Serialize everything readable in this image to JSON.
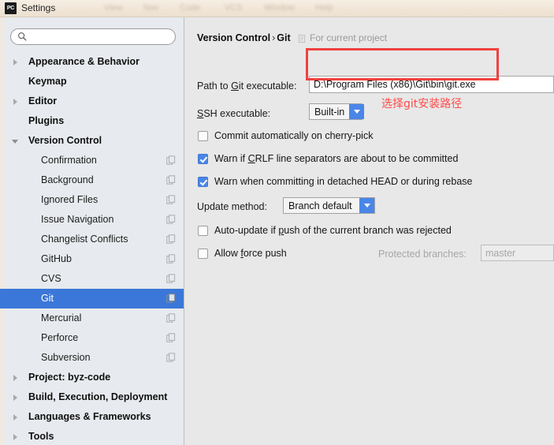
{
  "window": {
    "title": "Settings",
    "app_icon": "PC",
    "blurred_menu_items": [
      "View",
      "Nav",
      "Code",
      "VCS",
      "Window",
      "Help"
    ]
  },
  "sidebar": {
    "search": {
      "value": "",
      "placeholder": "",
      "icon": "search-icon"
    },
    "items": [
      {
        "label": "Appearance & Behavior",
        "level": "top",
        "arrow": "collapsed",
        "selected": false,
        "copy_icon": false
      },
      {
        "label": "Keymap",
        "level": "top",
        "arrow": "none",
        "selected": false,
        "copy_icon": false
      },
      {
        "label": "Editor",
        "level": "top",
        "arrow": "collapsed",
        "selected": false,
        "copy_icon": false
      },
      {
        "label": "Plugins",
        "level": "top",
        "arrow": "none",
        "selected": false,
        "copy_icon": false
      },
      {
        "label": "Version Control",
        "level": "top",
        "arrow": "expanded",
        "selected": false,
        "copy_icon": false
      },
      {
        "label": "Confirmation",
        "level": "child",
        "arrow": "none",
        "selected": false,
        "copy_icon": true
      },
      {
        "label": "Background",
        "level": "child",
        "arrow": "none",
        "selected": false,
        "copy_icon": true
      },
      {
        "label": "Ignored Files",
        "level": "child",
        "arrow": "none",
        "selected": false,
        "copy_icon": true
      },
      {
        "label": "Issue Navigation",
        "level": "child",
        "arrow": "none",
        "selected": false,
        "copy_icon": true
      },
      {
        "label": "Changelist Conflicts",
        "level": "child",
        "arrow": "none",
        "selected": false,
        "copy_icon": true
      },
      {
        "label": "GitHub",
        "level": "child",
        "arrow": "none",
        "selected": false,
        "copy_icon": true
      },
      {
        "label": "CVS",
        "level": "child",
        "arrow": "none",
        "selected": false,
        "copy_icon": true
      },
      {
        "label": "Git",
        "level": "child",
        "arrow": "none",
        "selected": true,
        "copy_icon": true
      },
      {
        "label": "Mercurial",
        "level": "child",
        "arrow": "none",
        "selected": false,
        "copy_icon": true
      },
      {
        "label": "Perforce",
        "level": "child",
        "arrow": "none",
        "selected": false,
        "copy_icon": true
      },
      {
        "label": "Subversion",
        "level": "child",
        "arrow": "none",
        "selected": false,
        "copy_icon": true
      },
      {
        "label": "Project: byz-code",
        "level": "top",
        "arrow": "collapsed",
        "selected": false,
        "copy_icon": false
      },
      {
        "label": "Build, Execution, Deployment",
        "level": "top",
        "arrow": "collapsed",
        "selected": false,
        "copy_icon": false
      },
      {
        "label": "Languages & Frameworks",
        "level": "top",
        "arrow": "collapsed",
        "selected": false,
        "copy_icon": false
      },
      {
        "label": "Tools",
        "level": "top",
        "arrow": "collapsed",
        "selected": false,
        "copy_icon": false
      }
    ]
  },
  "panel": {
    "breadcrumb_parent": "Version Control",
    "breadcrumb_sep": "›",
    "breadcrumb_current": "Git",
    "scope_text": "For current project",
    "scope_icon": "project-scope-icon",
    "git_path": {
      "label_pre": "Path to ",
      "label_accel": "G",
      "label_post": "it executable:",
      "value": "D:\\Program Files (x86)\\Git\\bin\\git.exe"
    },
    "ssh": {
      "label": "SSH executable:",
      "label_accel": "S",
      "value": "Built-in"
    },
    "checkboxes": [
      {
        "label_pre": "Commit automatically on cherry-pick",
        "accel": "",
        "label_post": "",
        "checked": false,
        "disabled": false
      },
      {
        "label_pre": "Warn if ",
        "accel": "C",
        "label_post": "RLF line separators are about to be committed",
        "checked": true,
        "disabled": false
      },
      {
        "label_pre": "Warn when committing in detached HEAD or during rebase",
        "accel": "",
        "label_post": "",
        "checked": true,
        "disabled": false
      },
      {
        "label_pre": "Auto-update if ",
        "accel": "p",
        "label_post": "ush of the current branch was rejected",
        "checked": false,
        "disabled": false
      },
      {
        "label_pre": "Allow ",
        "accel": "f",
        "label_post": "orce push",
        "checked": false,
        "disabled": false
      }
    ],
    "update_method": {
      "label": "Update method:",
      "value": "Branch default"
    },
    "protected_branches": {
      "label": "Protected branches:",
      "value": "master"
    }
  },
  "annotations": {
    "box_color": "#f0413f",
    "text_color": "#ff4b48",
    "note": "选择git安装路径"
  }
}
